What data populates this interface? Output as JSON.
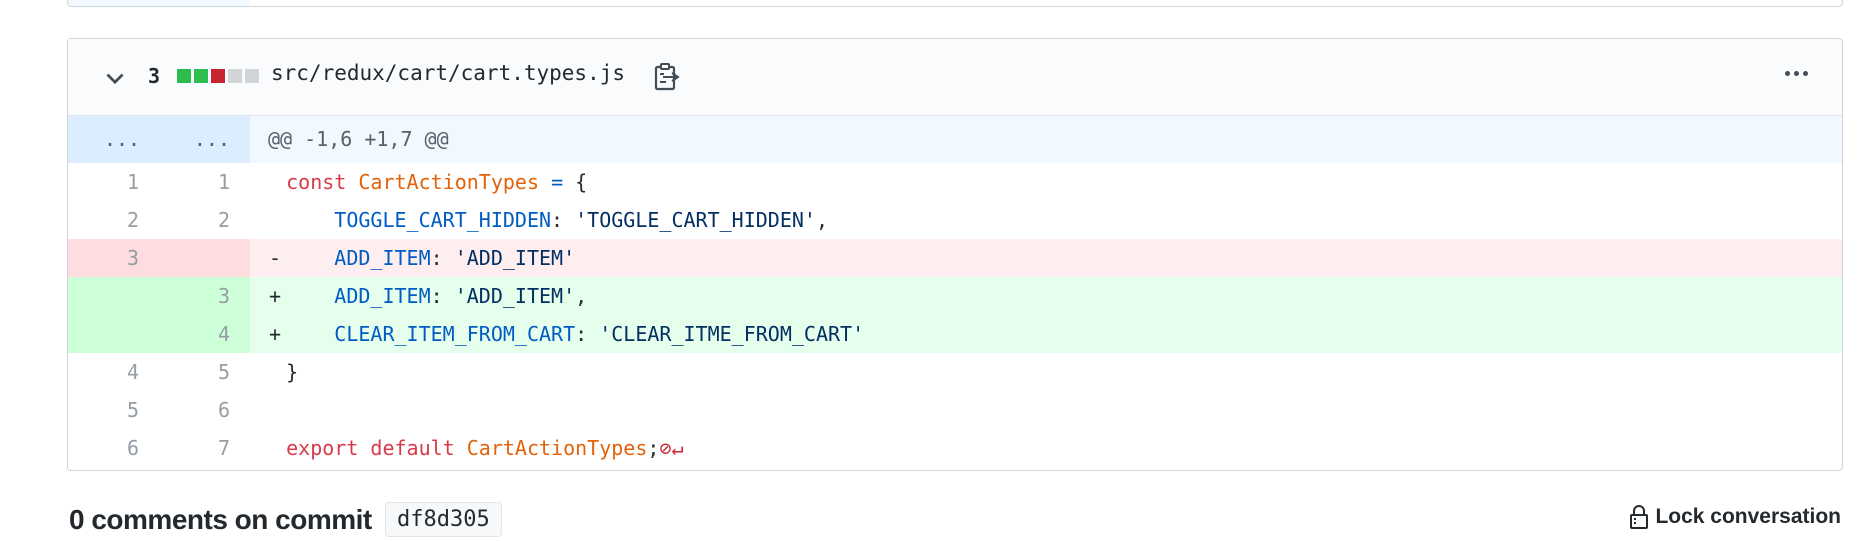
{
  "file": {
    "change_count": "3",
    "filename": "src/redux/cart/cart.types.js",
    "diffstat": {
      "green": 2,
      "red": 1,
      "gray": 2,
      "colors": {
        "green": "#2cbe4e",
        "red": "#cb2431",
        "gray": "#d1d5da"
      }
    }
  },
  "hunk": {
    "left": "...",
    "right": "...",
    "header": "@@ -1,6 +1,7 @@"
  },
  "lines": [
    {
      "type": "ctx",
      "left": "1",
      "right": "1"
    },
    {
      "type": "ctx",
      "left": "2",
      "right": "2"
    },
    {
      "type": "del",
      "left": "3",
      "right": "",
      "marker": "-"
    },
    {
      "type": "add",
      "left": "",
      "right": "3",
      "marker": "+"
    },
    {
      "type": "add",
      "left": "",
      "right": "4",
      "marker": "+"
    },
    {
      "type": "ctx",
      "left": "4",
      "right": "5"
    },
    {
      "type": "ctx",
      "left": "5",
      "right": "6"
    },
    {
      "type": "ctx",
      "left": "6",
      "right": "7"
    }
  ],
  "code": {
    "l1": {
      "kw": "const",
      "name": "CartActionTypes",
      "op": "=",
      "brace": "{"
    },
    "l2": {
      "key": "TOGGLE_CART_HIDDEN",
      "colon": ":",
      "val": "'TOGGLE_CART_HIDDEN'",
      "comma": ","
    },
    "l3": {
      "key": "ADD_ITEM",
      "colon": ":",
      "val": "'ADD_ITEM'"
    },
    "l4": {
      "key": "ADD_ITEM",
      "colon": ":",
      "val": "'ADD_ITEM'",
      "comma": ","
    },
    "l5": {
      "key": "CLEAR_ITEM_FROM_CART",
      "colon": ":",
      "val": "'CLEAR_ITME_FROM_CART'"
    },
    "l6": {
      "brace": "}"
    },
    "l8": {
      "kw1": "export",
      "kw2": "default",
      "name": "CartActionTypes",
      "semi": ";",
      "no_newline": "⊘↵"
    }
  },
  "footer": {
    "comments_title": "0 comments on commit",
    "sha": "df8d305",
    "lock_label": "Lock conversation"
  }
}
